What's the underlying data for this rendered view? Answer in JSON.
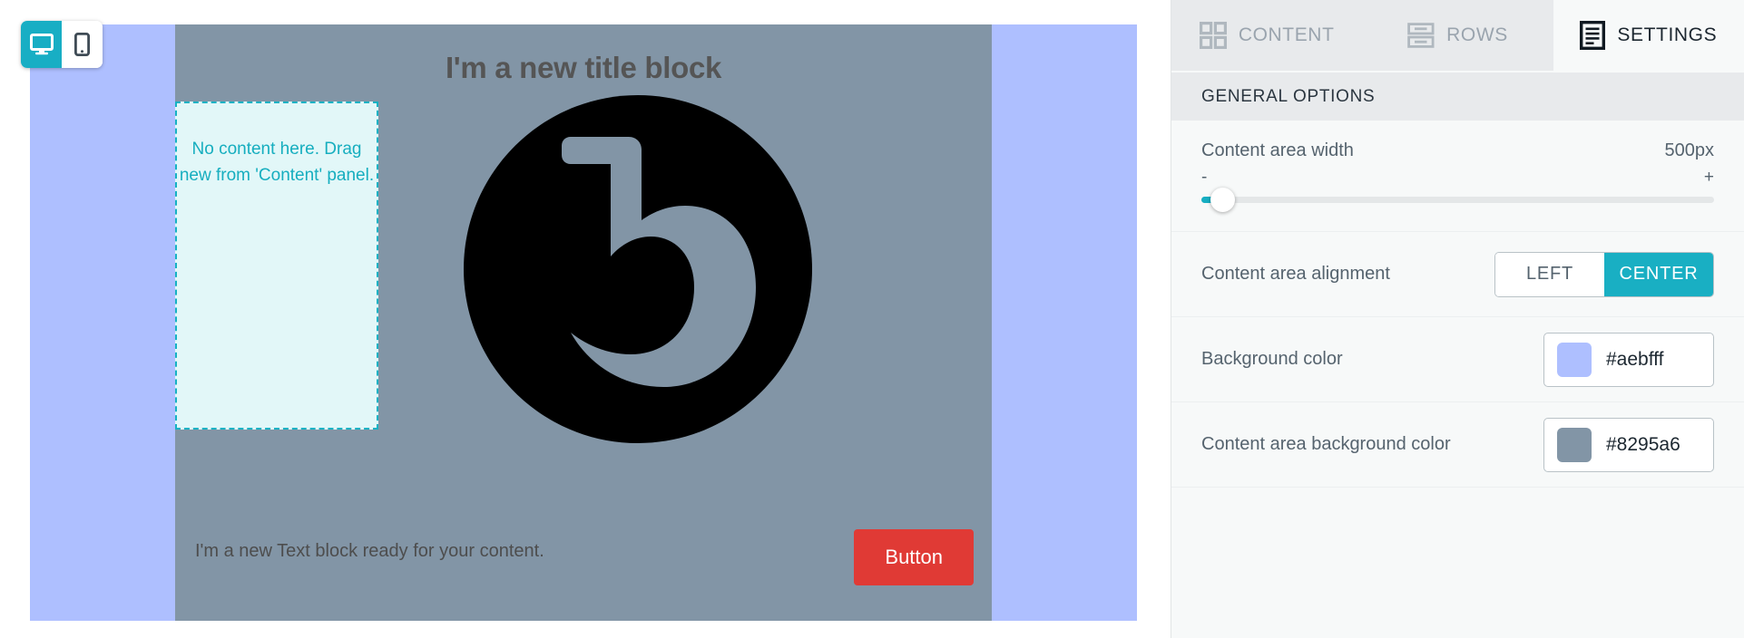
{
  "device_toggle": {
    "desktop": {
      "icon": "desktop-monitor-icon",
      "active": true
    },
    "mobile": {
      "icon": "mobile-phone-icon",
      "active": false
    }
  },
  "canvas": {
    "background_color": "#aebfff",
    "content_area_color": "#8295a6",
    "title_block": "I'm a new title block",
    "empty_placeholder": "No content here. Drag new from 'Content' panel.",
    "logo_alt": "b-logo",
    "text_block": "I'm a new Text block ready for your content.",
    "button_label": "Button",
    "button_color": "#e03a35"
  },
  "panel": {
    "tabs": [
      {
        "label": "CONTENT",
        "icon": "grid-squares-icon",
        "active": false
      },
      {
        "label": "ROWS",
        "icon": "rows-stack-icon",
        "active": false
      },
      {
        "label": "SETTINGS",
        "icon": "settings-list-icon",
        "active": true
      }
    ],
    "section_title": "GENERAL OPTIONS",
    "options": {
      "content_area_width": {
        "label": "Content area width",
        "value": "500px",
        "minus": "-",
        "plus": "+",
        "fill_color": "#16aec2"
      },
      "content_area_alignment": {
        "label": "Content area alignment",
        "choices": [
          "LEFT",
          "CENTER"
        ],
        "selected": "CENTER",
        "active_color": "#19afc3"
      },
      "background_color": {
        "label": "Background color",
        "value": "#aebfff"
      },
      "content_area_background_color": {
        "label": "Content area background color",
        "value": "#8295a6"
      }
    }
  }
}
